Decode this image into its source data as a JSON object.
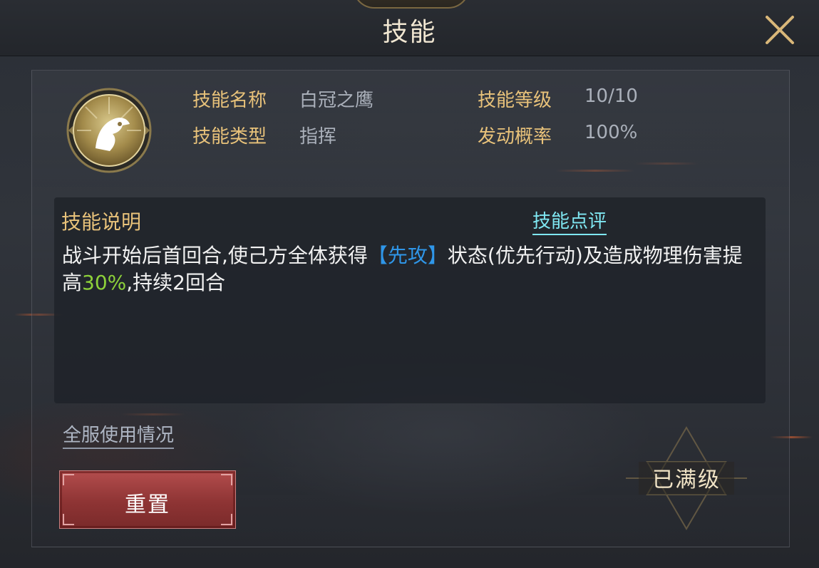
{
  "window": {
    "title": "技能",
    "close_icon": "close-icon"
  },
  "skill": {
    "icon": "eagle-head-icon",
    "name_label": "技能名称",
    "name_value": "白冠之鹰",
    "level_label": "技能等级",
    "level_value": "10/10",
    "type_label": "技能类型",
    "type_value": "指挥",
    "chance_label": "发动概率",
    "chance_value": "100%"
  },
  "description": {
    "title": "技能说明",
    "review_link": "技能点评",
    "text_part1": "战斗开始后首回合,使己方全体获得",
    "text_highlight_status": "【先攻】",
    "text_part2": "状态(优先行动)及造成物理伤害提高",
    "text_highlight_value": "30%",
    "text_part3": ",持续2回合"
  },
  "footer": {
    "usage_link": "全服使用情况",
    "reset_button": "重置",
    "max_level_badge": "已满级"
  },
  "colors": {
    "label_gold": "#e8c27a",
    "value_grey": "#aab0ba",
    "link_cyan": "#7fe7f2",
    "highlight_blue": "#2f96e8",
    "highlight_green": "#8dd13a",
    "reset_red": "#8e3434"
  }
}
